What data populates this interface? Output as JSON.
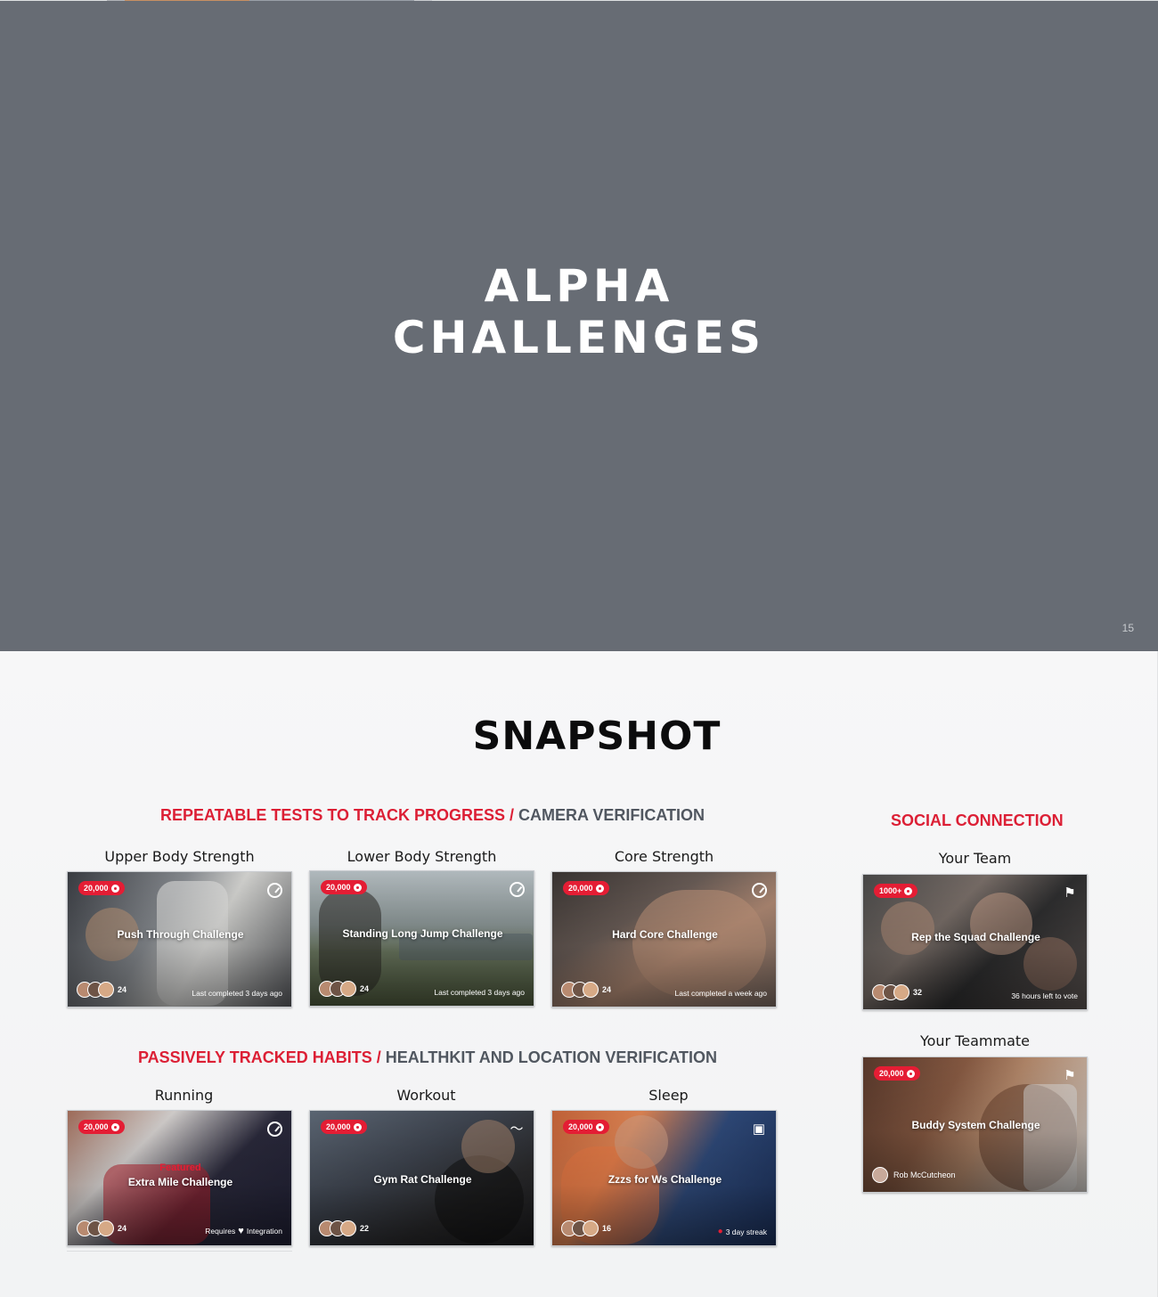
{
  "cover": {
    "title_line1": "ALPHA",
    "title_line2": "CHALLENGES",
    "page_number": "15",
    "background_color": "#676c74"
  },
  "snapshot": {
    "title": "SNAPSHOT",
    "accent_color": "#dc1f35",
    "repeatable": {
      "heading_accent": "REPEATABLE TESTS TO TRACK PROGRESS /",
      "heading_rest": " CAMERA VERIFICATION",
      "cards": [
        {
          "label": "Upper Body Strength",
          "points": "20,000",
          "title": "Push Through Challenge",
          "count": "24",
          "footer": "Last completed 3 days ago",
          "icon": "timer-icon"
        },
        {
          "label": "Lower Body Strength",
          "points": "20,000",
          "title": "Standing Long Jump Challenge",
          "count": "24",
          "footer": "Last completed 3 days ago",
          "icon": "timer-icon"
        },
        {
          "label": "Core Strength",
          "points": "20,000",
          "title": "Hard Core Challenge",
          "count": "24",
          "footer": "Last completed a week ago",
          "icon": "timer-icon"
        }
      ]
    },
    "passive": {
      "heading_accent": "PASSIVELY TRACKED HABITS /",
      "heading_rest": " HEALTHKIT AND LOCATION VERIFICATION",
      "cards": [
        {
          "label": "Running",
          "points": "20,000",
          "featured": "Featured",
          "title": "Extra Mile Challenge",
          "count": "24",
          "footer_pre": "Requires",
          "footer_post": "Integration",
          "icon": "timer-icon"
        },
        {
          "label": "Workout",
          "points": "20,000",
          "title": "Gym Rat Challenge",
          "count": "22",
          "icon": "heartbeat-icon"
        },
        {
          "label": "Sleep",
          "points": "20,000",
          "title": "Zzzs for Ws Challenge",
          "count": "16",
          "footer": "3 day streak",
          "icon": "sleep-icon"
        }
      ]
    },
    "social": {
      "heading": "SOCIAL CONNECTION",
      "team": {
        "label": "Your Team",
        "points": "1000+",
        "title": "Rep the Squad Challenge",
        "count": "32",
        "footer": "36 hours left to vote",
        "icon": "flag-icon"
      },
      "teammate": {
        "label": "Your Teammate",
        "points": "20,000",
        "title": "Buddy System Challenge",
        "person": "Rob McCutcheon",
        "icon": "flag-icon"
      }
    }
  }
}
